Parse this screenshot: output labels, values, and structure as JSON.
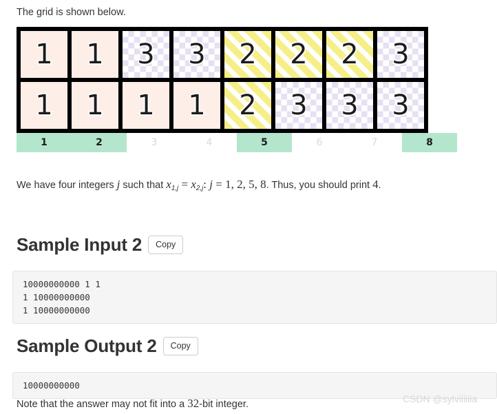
{
  "intro": {
    "text": "The grid is shown below."
  },
  "grid": {
    "rows": [
      [
        {
          "value": "1",
          "fill": "pink"
        },
        {
          "value": "1",
          "fill": "pink"
        },
        {
          "value": "3",
          "fill": "check"
        },
        {
          "value": "3",
          "fill": "check"
        },
        {
          "value": "2",
          "fill": "stripe"
        },
        {
          "value": "2",
          "fill": "stripe"
        },
        {
          "value": "2",
          "fill": "stripe"
        },
        {
          "value": "3",
          "fill": "check"
        }
      ],
      [
        {
          "value": "1",
          "fill": "pink"
        },
        {
          "value": "1",
          "fill": "pink"
        },
        {
          "value": "1",
          "fill": "pink"
        },
        {
          "value": "1",
          "fill": "pink"
        },
        {
          "value": "2",
          "fill": "stripe"
        },
        {
          "value": "3",
          "fill": "check"
        },
        {
          "value": "3",
          "fill": "check"
        },
        {
          "value": "3",
          "fill": "check"
        }
      ]
    ],
    "column_labels": [
      {
        "label": "1",
        "highlighted": true
      },
      {
        "label": "2",
        "highlighted": true
      },
      {
        "label": "3",
        "highlighted": false
      },
      {
        "label": "4",
        "highlighted": false
      },
      {
        "label": "5",
        "highlighted": true
      },
      {
        "label": "6",
        "highlighted": false
      },
      {
        "label": "7",
        "highlighted": false
      },
      {
        "label": "8",
        "highlighted": true
      }
    ],
    "colors": {
      "pink": "#fdeee8",
      "checker": "#e6e0f2",
      "stripe": "#f6ef88",
      "label_highlight": "#b3e6cd",
      "label_dim": "#d9d9d9",
      "border": "#000000"
    }
  },
  "explanation": {
    "part1": "We have four integers ",
    "math_j": "j",
    "part2": " such that ",
    "math_x1": "x",
    "math_x1_sub": "1,j",
    "math_eq": " = ",
    "math_x2": "x",
    "math_x2_sub": "2,j",
    "math_colon": ": ",
    "math_j2": "j",
    "math_eq2": " = ",
    "math_values": "1, 2, 5, 8",
    "part3": ". Thus, you should print ",
    "math_answer": "4",
    "part4": "."
  },
  "sample_input": {
    "heading": "Sample Input 2",
    "copy_label": "Copy",
    "code": "10000000000 1 1\n1 10000000000\n1 10000000000"
  },
  "sample_output": {
    "heading": "Sample Output 2",
    "copy_label": "Copy",
    "code": "10000000000"
  },
  "note": {
    "part1": "Note that the answer may not fit into a ",
    "math_bits": "32",
    "part2": "-bit integer."
  },
  "watermark": {
    "text": "CSDN @sylviiiiiia"
  }
}
